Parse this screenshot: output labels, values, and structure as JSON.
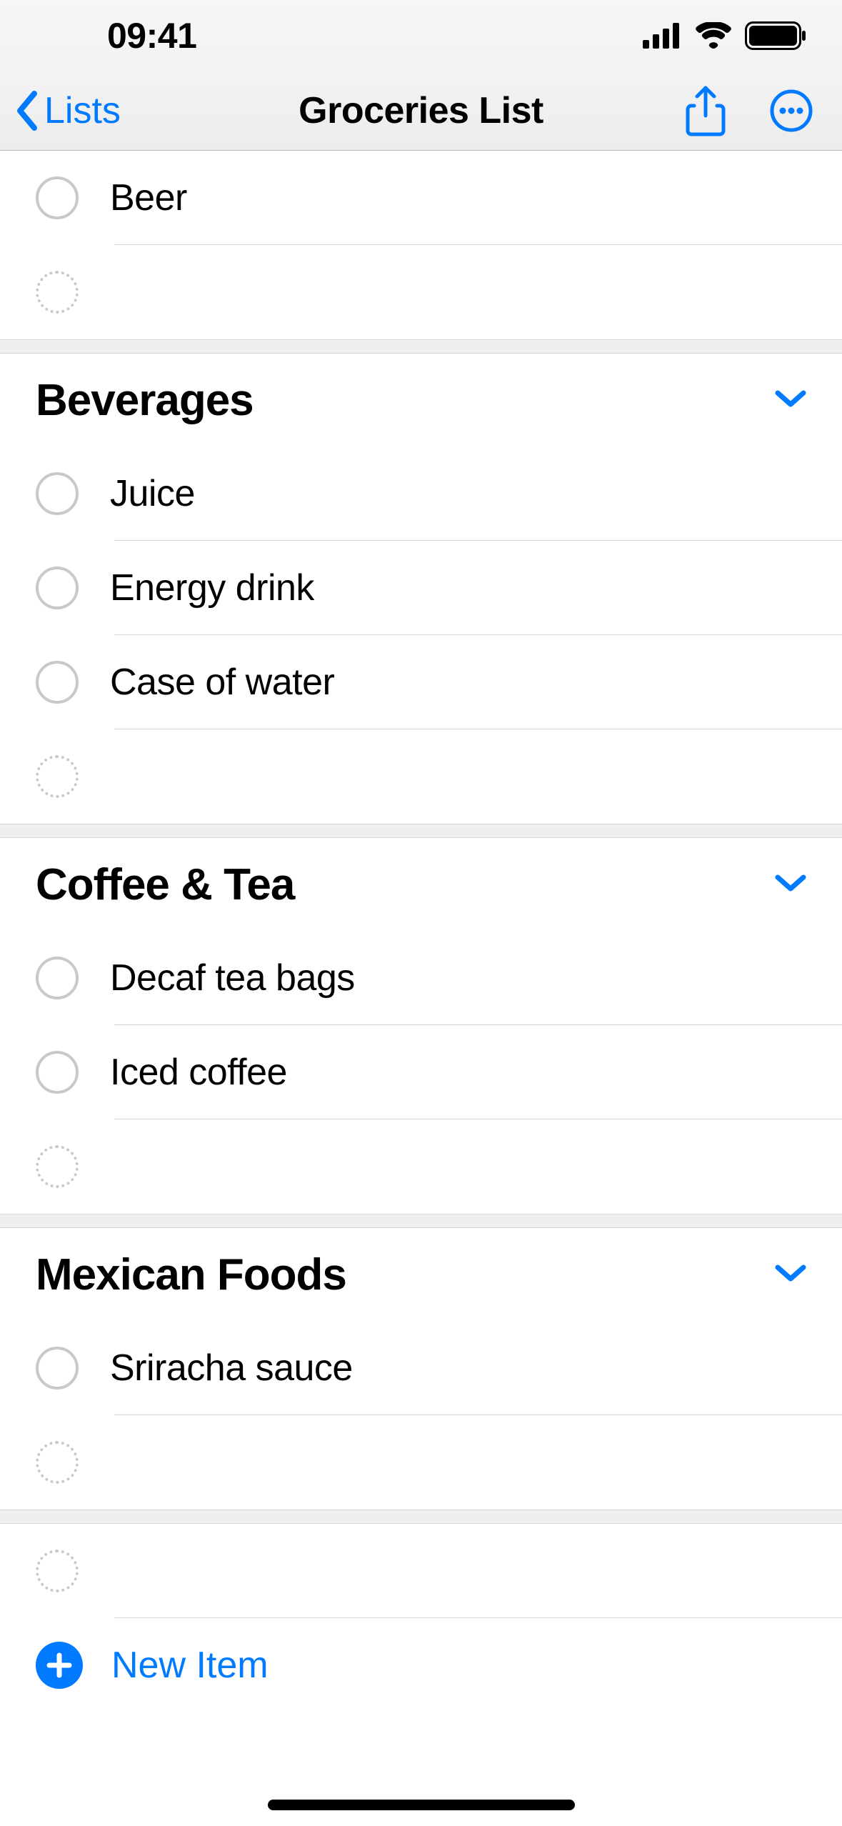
{
  "status": {
    "time": "09:41"
  },
  "nav": {
    "back_label": "Lists",
    "title": "Groceries List"
  },
  "top_items": [
    {
      "label": "Beer"
    }
  ],
  "sections": [
    {
      "title": "Beverages",
      "items": [
        {
          "label": "Juice"
        },
        {
          "label": "Energy drink"
        },
        {
          "label": "Case of water"
        }
      ]
    },
    {
      "title": "Coffee & Tea",
      "items": [
        {
          "label": "Decaf tea bags"
        },
        {
          "label": "Iced coffee"
        }
      ]
    },
    {
      "title": "Mexican Foods",
      "items": [
        {
          "label": "Sriracha sauce"
        }
      ]
    }
  ],
  "footer": {
    "new_item_label": "New Item"
  }
}
